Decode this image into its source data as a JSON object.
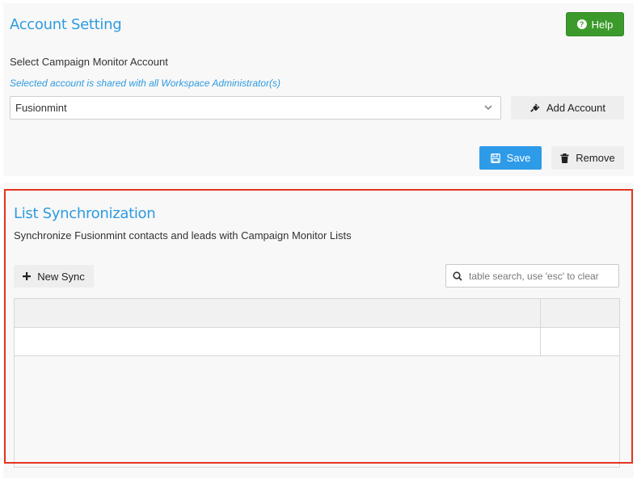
{
  "account": {
    "title": "Account Setting",
    "help_label": "Help",
    "select_label": "Select Campaign Monitor Account",
    "shared_note": "Selected account is shared with all Workspace Administrator(s)",
    "selected_account": "Fusionmint",
    "add_account_label": "Add Account",
    "save_label": "Save",
    "remove_label": "Remove"
  },
  "sync": {
    "title": "List Synchronization",
    "description": "Synchronize Fusionmint contacts and leads with Campaign Monitor Lists",
    "new_sync_label": "New Sync",
    "search_placeholder": "table search, use 'esc' to clear"
  },
  "icons": {
    "help": "question-circle-icon",
    "dropdown": "chevron-down-icon",
    "add_account": "plug-icon",
    "save": "floppy-disk-icon",
    "remove": "trash-icon",
    "new_sync": "plus-icon",
    "search": "search-icon"
  },
  "colors": {
    "accent_blue": "#2e9be0",
    "help_green": "#3c9a2c",
    "save_blue": "#2e9be8",
    "highlight_red": "#e53420"
  }
}
